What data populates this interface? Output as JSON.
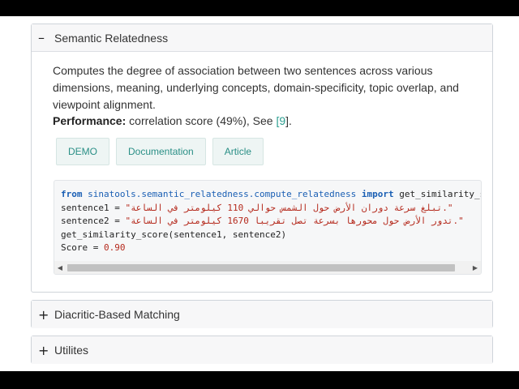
{
  "sections": [
    {
      "sign": "–",
      "title": "Semantic Relatedness",
      "description": "Computes the degree of association between two sentences across various dimensions, meaning, underlying concepts, domain-specificity, topic overlap, and viewpoint alignment.",
      "performance_label": "Performance:",
      "performance_text": " correlation score (49%), See ",
      "reference_open": "[",
      "reference_num": "9",
      "reference_close": "].",
      "buttons": [
        "DEMO",
        "Documentation",
        "Article"
      ],
      "code": {
        "line1_kw1": "from",
        "line1_module": "sinatools.semantic_relatedness.compute_relatedness",
        "line1_kw2": "import",
        "line1_func": "get_similarity_score",
        "line2_var": "sentence1 = ",
        "line2_str": "\"تبلغ سرعة دوران الأرض حول الشمس حوالي 110 كيلومتر في الساعة.\"",
        "line3_var": "sentence2 = ",
        "line3_str": "\"تدور الأرض حول محورها بسرعة تصل تقريبا 1670 كيلومتر في الساعة.\"",
        "line4": "get_similarity_score(sentence1, sentence2)",
        "line5_prefix": "Score = ",
        "line5_value": "0.90"
      }
    },
    {
      "sign": "+",
      "title": "Diacritic-Based Matching"
    },
    {
      "sign": "+",
      "title": "Utilites"
    }
  ],
  "icons": {
    "scroll_left": "triangle-left",
    "scroll_right": "triangle-right"
  }
}
